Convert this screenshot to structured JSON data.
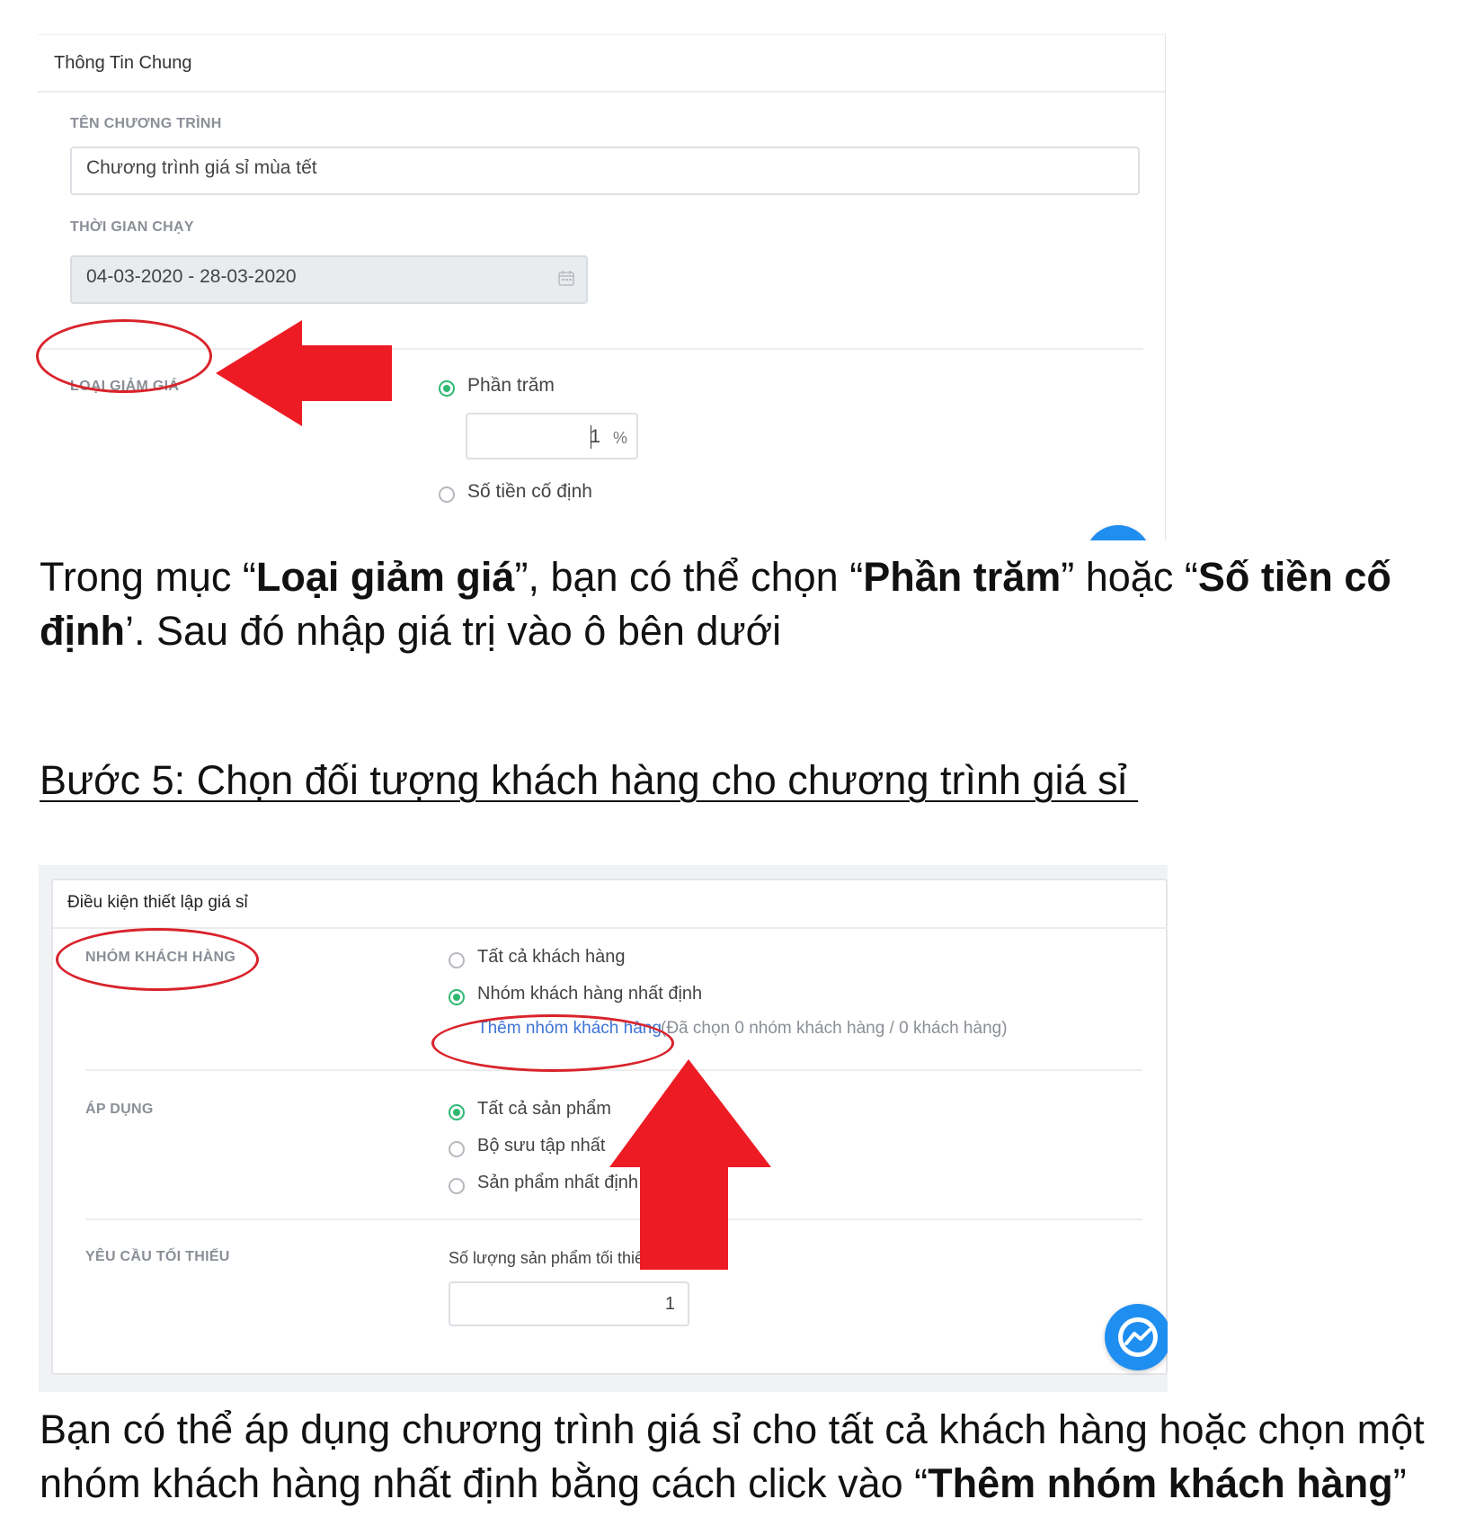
{
  "shot1": {
    "header_title": "Thông Tin Chung",
    "program_name_label": "TÊN CHƯƠNG TRÌNH",
    "program_name_value": "Chương trình giá sỉ mùa tết",
    "run_time_label": "THỜI GIAN CHẠY",
    "run_time_value": "04-03-2020 - 28-03-2020",
    "discount_type_label": "LOẠI GIẢM GIÁ",
    "option_percent": "Phần trăm",
    "percent_value": "1",
    "percent_unit": "%",
    "option_fixed": "Số tiền cố định",
    "selected_option": "Phần trăm"
  },
  "para1": {
    "t1": "Trong mục “",
    "b1": "Loại giảm giá",
    "t2": "”, bạn có thể chọn “",
    "b2": "Phần trăm",
    "t3": "” hoặc “",
    "b3": "Số tiền cố định",
    "t4": "’. Sau đó nhập giá trị vào ô bên dưới"
  },
  "step_heading": "Bước 5: Chọn đối tượng khách hàng cho chương trình giá sỉ ",
  "shot2": {
    "card_title": "Điều kiện thiết lập giá sỉ",
    "customer_group_label": "NHÓM KHÁCH HÀNG",
    "opt_all_customers": "Tất cả khách hàng",
    "opt_specific_group": "Nhóm khách hàng nhất định",
    "add_group_link": "Thêm nhóm khách hàng",
    "selected_note": "(Đã chọn 0 nhóm khách hàng / 0 khách hàng)",
    "apply_label": "ÁP DỤNG",
    "opt_all_products": "Tất cả sản phẩm",
    "opt_collection": "Bộ sưu tập nhất",
    "opt_specific_products": "Sản phẩm nhất định",
    "min_req_label": "YÊU CẦU TỐI THIẾU",
    "min_qty_label": "Số lượng sản phẩm tối thiể",
    "min_qty_value": "1"
  },
  "para2": {
    "t1": "Bạn có thể áp dụng chương trình giá sỉ cho tất cả khách hàng hoặc chọn một nhóm khách hàng nhất định bằng cách click vào “",
    "b1": "Thêm nhóm khách hàng",
    "t2": "”"
  },
  "colors": {
    "annotation_red": "#d9232b",
    "arrow_red": "#ed1c24",
    "radio_green": "#2eb872",
    "link_blue": "#3f74d6",
    "messenger_blue": "#1f8ef1"
  },
  "icons": [
    "calendar-icon",
    "left-arrow-annotation",
    "up-arrow-annotation",
    "messenger-icon"
  ]
}
